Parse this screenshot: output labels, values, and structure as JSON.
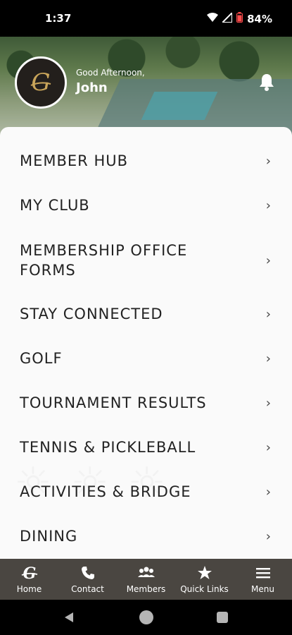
{
  "status": {
    "time": "1:37",
    "battery": "84%",
    "icons": [
      "wifi-icon",
      "signal-icon",
      "battery-icon"
    ]
  },
  "header": {
    "greeting": "Good Afternoon,",
    "name": "John",
    "logo_letter": "G",
    "notification_icon": "bell-icon"
  },
  "menu": {
    "items": [
      {
        "label": "MEMBER HUB"
      },
      {
        "label": "MY CLUB"
      },
      {
        "label": "MEMBERSHIP OFFICE FORMS"
      },
      {
        "label": "STAY CONNECTED"
      },
      {
        "label": "GOLF"
      },
      {
        "label": "TOURNAMENT RESULTS"
      },
      {
        "label": "TENNIS & PICKLEBALL"
      },
      {
        "label": "ACTIVITIES & BRIDGE"
      },
      {
        "label": "DINING"
      }
    ],
    "chevron": "›"
  },
  "tabbar": {
    "tabs": [
      {
        "label": "Home",
        "icon": "club-logo-icon"
      },
      {
        "label": "Contact",
        "icon": "phone-icon"
      },
      {
        "label": "Members",
        "icon": "members-icon"
      },
      {
        "label": "Quick Links",
        "icon": "star-icon"
      },
      {
        "label": "Menu",
        "icon": "hamburger-icon"
      }
    ]
  },
  "colors": {
    "tabbar_bg": "#4a4641",
    "panel_bg": "#fafafa",
    "text": "#222222",
    "logo_gold": "#c9a55a"
  }
}
